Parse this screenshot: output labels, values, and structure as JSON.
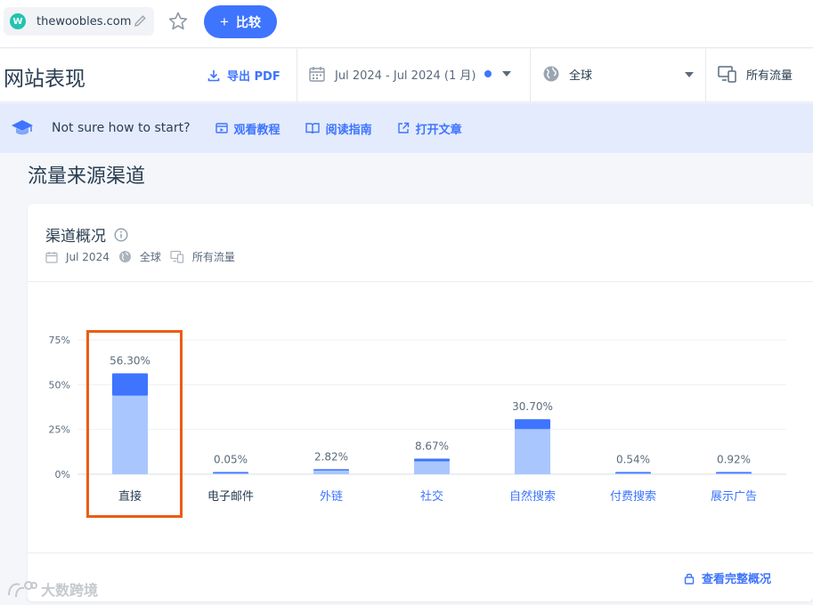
{
  "topbar": {
    "site_initial": "W",
    "site_domain": "thewoobles.com",
    "compare_label": "比较"
  },
  "header": {
    "page_title": "网站表现",
    "export_label": "导出 PDF",
    "date_range": "Jul 2024 - Jul 2024 (1 月)",
    "geo": "全球",
    "traffic": "所有流量"
  },
  "banner": {
    "question": "Not sure how to start?",
    "links": [
      "观看教程",
      "阅读指南",
      "打开文章"
    ]
  },
  "section_title": "流量来源渠道",
  "card": {
    "title": "渠道概况",
    "meta_date": "Jul 2024",
    "meta_geo": "全球",
    "meta_traffic": "所有流量",
    "full_overview_label": "查看完整概况"
  },
  "watermark": "大数跨境",
  "colors": {
    "accent": "#3e74fe",
    "bar_light": "#a9c7fe",
    "bar_dark": "#3e74fe",
    "highlight": "#ea5d14"
  },
  "chart_data": {
    "type": "bar",
    "categories": [
      "直接",
      "电子邮件",
      "外链",
      "社交",
      "自然搜索",
      "付费搜索",
      "展示广告"
    ],
    "values": [
      56.3,
      0.05,
      2.82,
      8.67,
      30.7,
      0.54,
      0.92
    ],
    "value_labels": [
      "56.30%",
      "0.05%",
      "2.82%",
      "8.67%",
      "30.70%",
      "0.54%",
      "0.92%"
    ],
    "y_ticks": [
      "0%",
      "25%",
      "50%",
      "75%"
    ],
    "ylim": [
      0,
      75
    ],
    "grid": true,
    "highlighted_category": "直接"
  }
}
